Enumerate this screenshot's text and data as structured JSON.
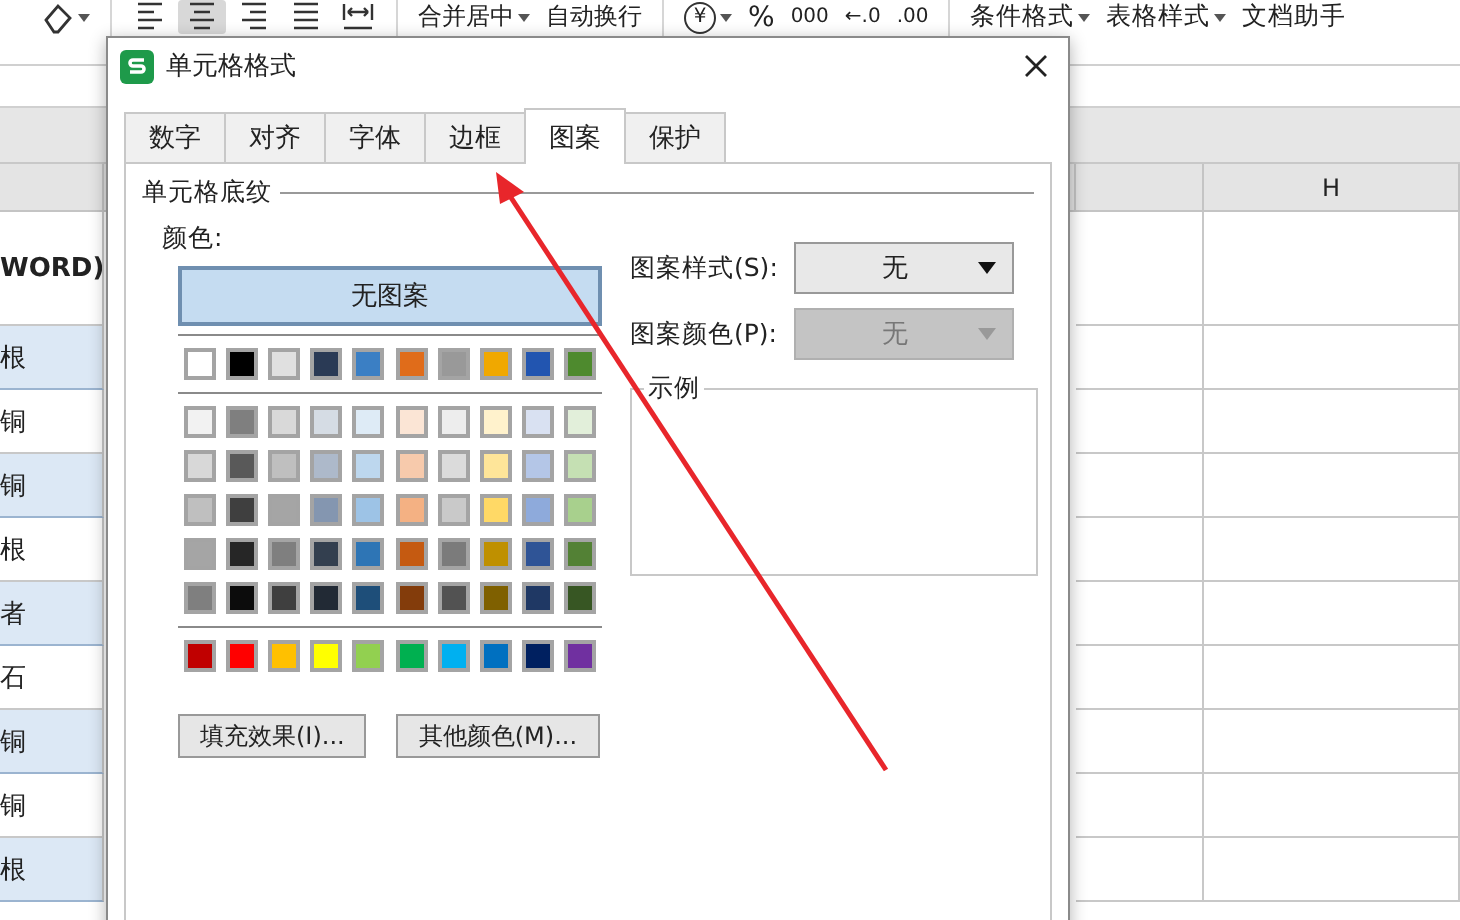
{
  "toolbar": {
    "align_buttons": [
      {
        "kind": "left",
        "selected": false
      },
      {
        "kind": "center",
        "selected": true
      },
      {
        "kind": "right",
        "selected": false
      },
      {
        "kind": "justify",
        "selected": false
      },
      {
        "kind": "distributed",
        "selected": false
      }
    ],
    "merge_buttons": [
      {
        "label": "合并居中",
        "dropdown": true
      },
      {
        "label": "自动换行",
        "dropdown": false
      }
    ],
    "number_buttons": [
      {
        "kind": "currency",
        "label": "¥"
      },
      {
        "kind": "text",
        "label": "%"
      },
      {
        "kind": "text",
        "label": "000"
      },
      {
        "kind": "text",
        "label": "←.0"
      },
      {
        "kind": "text",
        "label": ".00"
      }
    ],
    "style_buttons": [
      {
        "label": "条件格式",
        "dropdown": true
      },
      {
        "label": "表格样式",
        "dropdown": true
      },
      {
        "label": "文档助手",
        "dropdown": false
      }
    ]
  },
  "sheet": {
    "column_headers": [
      "H"
    ],
    "left_cells": [
      {
        "text": "WORD)",
        "highlighted": false
      },
      {
        "text": "根",
        "highlighted": true
      },
      {
        "text": "铜",
        "highlighted": false
      },
      {
        "text": "铜",
        "highlighted": true
      },
      {
        "text": "根",
        "highlighted": false
      },
      {
        "text": "者",
        "highlighted": true
      },
      {
        "text": "石",
        "highlighted": false
      },
      {
        "text": "铜",
        "highlighted": true
      },
      {
        "text": "铜",
        "highlighted": false
      },
      {
        "text": "根",
        "highlighted": true
      }
    ]
  },
  "dialog": {
    "title": "单元格格式",
    "tabs": [
      {
        "label": "数字",
        "selected": false
      },
      {
        "label": "对齐",
        "selected": false
      },
      {
        "label": "字体",
        "selected": false
      },
      {
        "label": "边框",
        "selected": false
      },
      {
        "label": "图案",
        "selected": true
      },
      {
        "label": "保护",
        "selected": false
      }
    ],
    "group_title": "单元格底纹",
    "color_label": "颜色:",
    "no_pattern": {
      "label": "无图案",
      "selected": true
    },
    "palette": [
      [
        {
          "color": "#ffffff"
        },
        {
          "color": "#000000"
        },
        {
          "color": "#e0e0e0"
        },
        {
          "color": "#2a3a55"
        },
        {
          "color": "#3b7fc4"
        },
        {
          "color": "#e06c1a"
        },
        {
          "color": "#999999"
        },
        {
          "color": "#f0a800"
        },
        {
          "color": "#2255b0"
        },
        {
          "color": "#4e8a2e"
        }
      ],
      [
        {
          "color": "#f2f2f2"
        },
        {
          "color": "#7f7f7f"
        },
        {
          "color": "#d9d9d9"
        },
        {
          "color": "#d5dce4"
        },
        {
          "color": "#deebf6"
        },
        {
          "color": "#fbe5d5"
        },
        {
          "color": "#ededed"
        },
        {
          "color": "#fff2cc"
        },
        {
          "color": "#d9e1f2"
        },
        {
          "color": "#e2efda"
        }
      ],
      [
        {
          "color": "#d8d8d8"
        },
        {
          "color": "#595959"
        },
        {
          "color": "#bfbfbf"
        },
        {
          "color": "#adb9ca"
        },
        {
          "color": "#bdd7ee"
        },
        {
          "color": "#f7caac"
        },
        {
          "color": "#dbdbdb"
        },
        {
          "color": "#fee599"
        },
        {
          "color": "#b4c6e7"
        },
        {
          "color": "#c5e0b3"
        }
      ],
      [
        {
          "color": "#bfbfbf"
        },
        {
          "color": "#3f3f3f"
        },
        {
          "color": "#a5a5a5"
        },
        {
          "color": "#8496b0"
        },
        {
          "color": "#9dc3e6"
        },
        {
          "color": "#f4b183"
        },
        {
          "color": "#c9c9c9"
        },
        {
          "color": "#ffd966"
        },
        {
          "color": "#8eaadb"
        },
        {
          "color": "#a8d08d"
        }
      ],
      [
        {
          "color": "#a5a5a5"
        },
        {
          "color": "#262626"
        },
        {
          "color": "#7f7f7f"
        },
        {
          "color": "#333f4f"
        },
        {
          "color": "#2e75b5"
        },
        {
          "color": "#c55a11"
        },
        {
          "color": "#7b7b7b"
        },
        {
          "color": "#bf9000"
        },
        {
          "color": "#2f5496"
        },
        {
          "color": "#538135"
        }
      ],
      [
        {
          "color": "#7f7f7f"
        },
        {
          "color": "#0c0c0c"
        },
        {
          "color": "#3f3f3f"
        },
        {
          "color": "#222a35"
        },
        {
          "color": "#1e4e79"
        },
        {
          "color": "#833c0b"
        },
        {
          "color": "#525252"
        },
        {
          "color": "#7f6000"
        },
        {
          "color": "#1f3864"
        },
        {
          "color": "#375623"
        }
      ],
      [
        {
          "color": "#c00000"
        },
        {
          "color": "#ff0000"
        },
        {
          "color": "#ffc000"
        },
        {
          "color": "#ffff00"
        },
        {
          "color": "#92d050"
        },
        {
          "color": "#00b050"
        },
        {
          "color": "#00b0f0"
        },
        {
          "color": "#0070c0"
        },
        {
          "color": "#002060"
        },
        {
          "color": "#7030a0"
        }
      ]
    ],
    "buttons": [
      "填充效果(I)...",
      "其他颜色(M)..."
    ],
    "pattern_style": {
      "label": "图案样式(S):",
      "value": "无",
      "disabled": false
    },
    "pattern_color": {
      "label": "图案颜色(P):",
      "value": "无",
      "disabled": true
    },
    "sample_title": "示例"
  }
}
